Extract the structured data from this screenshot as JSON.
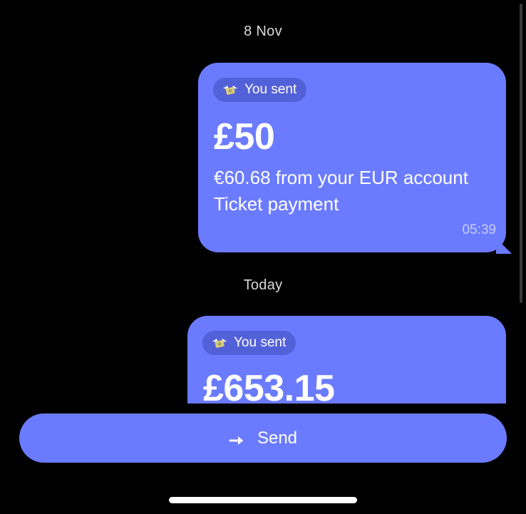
{
  "timeline": {
    "dates": [
      "8 Nov",
      "Today"
    ]
  },
  "messages": [
    {
      "badge_icon": "money-wings-icon",
      "badge_label": "You sent",
      "amount": "£50",
      "detail_line1": "€60.68 from your EUR account",
      "detail_line2": "Ticket payment",
      "time": "05:39"
    },
    {
      "badge_icon": "money-wings-icon",
      "badge_label": "You sent",
      "amount": "£653.15"
    }
  ],
  "composer": {
    "send_label": "Send",
    "send_icon": "arrow-right-icon"
  },
  "colors": {
    "bubble": "#6b7bff",
    "badge": "#5361d8",
    "background": "#000000"
  }
}
